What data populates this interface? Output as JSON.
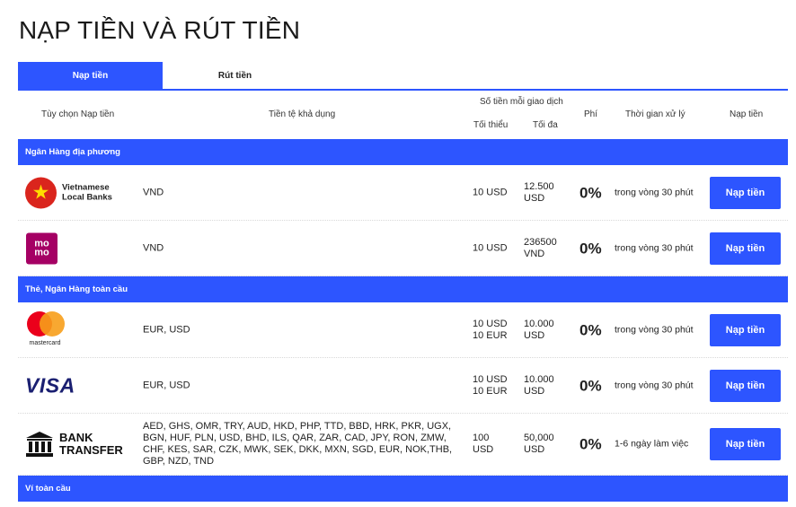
{
  "page": {
    "title": "NẠP TIỀN VÀ RÚT TIỀN"
  },
  "tabs": [
    {
      "label": "Nạp tiền",
      "active": true
    },
    {
      "label": "Rút tiền",
      "active": false
    }
  ],
  "table_header": {
    "option": "Tùy chọn Nạp tiền",
    "currency": "Tiền tệ khả dụng",
    "amount_per_txn": "Số tiền mỗi giao dịch",
    "min": "Tối thiểu",
    "max": "Tối đa",
    "fee": "Phí",
    "time": "Thời gian xử lý",
    "action": "Nạp tiền"
  },
  "sections": [
    {
      "label": "Ngân Hàng địa phương"
    },
    {
      "label": "Thẻ, Ngân Hàng toàn cầu"
    },
    {
      "label": "Ví toàn cầu"
    }
  ],
  "logos": {
    "vn_banks": {
      "line1": "Vietnamese",
      "line2": "Local Banks",
      "icon": "vietnam-flag-star-icon"
    },
    "momo": {
      "line1": "mo",
      "line2": "mo",
      "icon": "momo-logo"
    },
    "mastercard": {
      "text": "mastercard",
      "icon": "mastercard-logo"
    },
    "visa": {
      "text": "VISA",
      "icon": "visa-logo"
    },
    "bank_transfer": {
      "line1": "BANK",
      "line2": "TRANSFER",
      "icon": "bank-building-icon"
    }
  },
  "rows": [
    {
      "currency": "VND",
      "min": [
        "10 USD"
      ],
      "max": [
        "12.500",
        "USD"
      ],
      "fee": "0%",
      "time": "trong vòng 30 phút",
      "button": "Nạp tiền"
    },
    {
      "currency": "VND",
      "min": [
        "10 USD"
      ],
      "max": [
        "236500",
        "VND"
      ],
      "fee": "0%",
      "time": "trong vòng 30 phút",
      "button": "Nạp tiền"
    },
    {
      "currency": "EUR, USD",
      "min": [
        "10 USD",
        "10 EUR"
      ],
      "max": [
        "10.000",
        "USD"
      ],
      "fee": "0%",
      "time": "trong vòng 30 phút",
      "button": "Nạp tiền"
    },
    {
      "currency": "EUR, USD",
      "min": [
        "10 USD",
        "10 EUR"
      ],
      "max": [
        "10.000",
        "USD"
      ],
      "fee": "0%",
      "time": "trong vòng 30 phút",
      "button": "Nạp tiền"
    },
    {
      "currency": "AED, GHS, OMR, TRY, AUD, HKD, PHP, TTD, BBD, HRK, PKR, UGX, BGN, HUF, PLN, USD, BHD, ILS, QAR, ZAR, CAD, JPY, RON, ZMW, CHF, KES, SAR, CZK, MWK, SEK, DKK, MXN, SGD, EUR, NOK,THB, GBP, NZD, TND",
      "min": [
        "100",
        "USD"
      ],
      "max": [
        "50,000",
        "USD"
      ],
      "fee": "0%",
      "time": "1-6 ngày làm việc",
      "button": "Nạp tiền"
    }
  ],
  "colors": {
    "accent": "#2d55ff",
    "momo": "#a50064",
    "vn_red": "#da251d",
    "visa": "#1a1f71"
  }
}
